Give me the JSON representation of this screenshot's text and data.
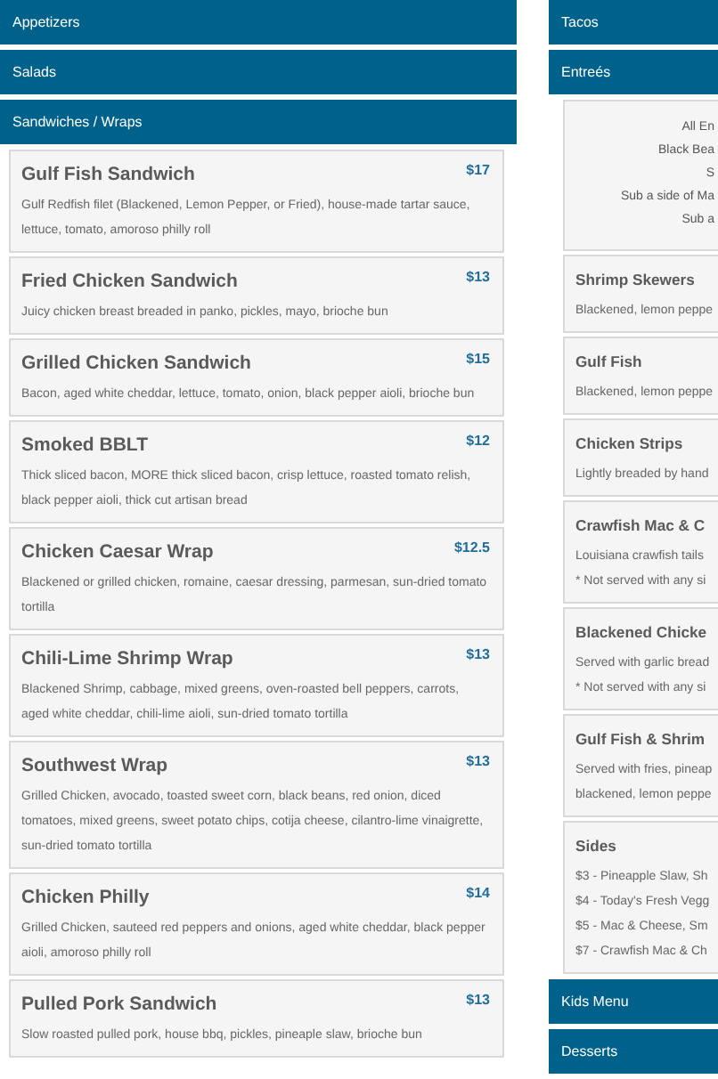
{
  "columns": [
    {
      "sections": [
        {
          "title": "Appetizers"
        },
        {
          "title": "Salads"
        },
        {
          "title": "Sandwiches / Wraps",
          "items": [
            {
              "name": "Gulf Fish Sandwich",
              "price": "$17",
              "description": [
                "Gulf Redfish filet (Blackened, Lemon Pepper, or Fried), house-made tartar sauce, lettuce, tomato, amoroso philly roll"
              ]
            },
            {
              "name": "Fried Chicken Sandwich",
              "price": "$13",
              "description": [
                "Juicy chicken breast breaded in panko, pickles, mayo, brioche bun"
              ]
            },
            {
              "name": "Grilled Chicken Sandwich",
              "price": "$15",
              "description": [
                "Bacon, aged white cheddar, lettuce, tomato, onion, black pepper aioli, brioche bun"
              ]
            },
            {
              "name": "Smoked BBLT",
              "price": "$12",
              "description": [
                "Thick sliced bacon, MORE thick sliced bacon, crisp lettuce, roasted tomato relish, black pepper aioli, thick cut artisan bread"
              ]
            },
            {
              "name": "Chicken Caesar Wrap",
              "price": "$12.5",
              "description": [
                "Blackened or grilled chicken, romaine, caesar dressing, parmesan, sun-dried tomato tortilla"
              ]
            },
            {
              "name": "Chili-Lime Shrimp Wrap",
              "price": "$13",
              "description": [
                "Blackened Shrimp, cabbage, mixed greens, oven-roasted bell peppers, carrots, aged white cheddar, chili-lime aioli, sun-dried tomato tortilla"
              ]
            },
            {
              "name": "Southwest Wrap",
              "price": "$13",
              "description": [
                "Grilled Chicken, avocado, toasted sweet corn, black beans, red onion, diced tomatoes, mixed greens, sweet potato chips, cotija cheese, cilantro-lime vinaigrette, sun-dried tomato tortilla"
              ]
            },
            {
              "name": "Chicken Philly",
              "price": "$14",
              "description": [
                "Grilled Chicken, sauteed red peppers and onions, aged white cheddar, black pepper aioli, amoroso philly roll"
              ]
            },
            {
              "name": "Pulled Pork Sandwich",
              "price": "$13",
              "description": [
                "Slow roasted pulled pork, house bbq, pickles, pineaple slaw, brioche bun"
              ]
            }
          ]
        }
      ]
    },
    {
      "sections": [
        {
          "title": "Tacos"
        },
        {
          "title": "Entreés",
          "intro": [
            "All En",
            "Black Bea",
            "S",
            "Sub a side of Ma",
            "Sub a"
          ],
          "items": [
            {
              "name": "Shrimp Skewers",
              "description": [
                "Blackened, lemon peppe"
              ]
            },
            {
              "name": "Gulf Fish",
              "description": [
                "Blackened, lemon peppe"
              ]
            },
            {
              "name": "Chicken Strips",
              "description": [
                "Lightly breaded by hand"
              ]
            },
            {
              "name": "Crawfish Mac & C",
              "description": [
                "Louisiana crawfish tails",
                "* Not served with any si"
              ]
            },
            {
              "name": "Blackened Chicke",
              "description": [
                "Served with garlic bread",
                "* Not served with any si"
              ]
            },
            {
              "name": "Gulf Fish & Shrim",
              "description": [
                "Served with fries, pineap",
                "blackened, lemon peppe"
              ]
            },
            {
              "name": "Sides",
              "description": [
                "$3 - Pineapple Slaw, Sh",
                "$4 - Today's Fresh Vegg",
                "$5 - Mac & Cheese, Sm",
                "$7 - Crawfish Mac & Ch"
              ]
            }
          ]
        },
        {
          "title": "Kids Menu"
        },
        {
          "title": "Desserts"
        }
      ]
    }
  ]
}
